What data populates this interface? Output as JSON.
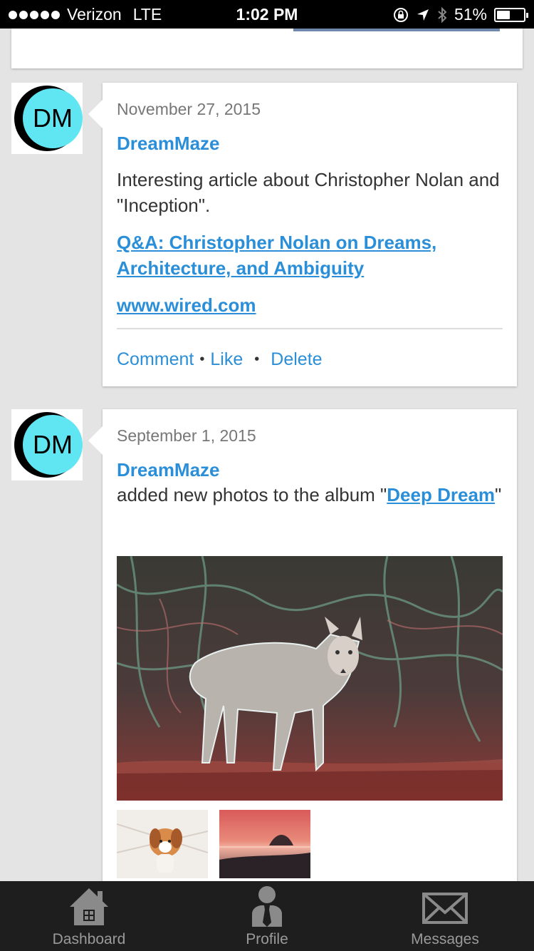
{
  "status_bar": {
    "carrier": "Verizon",
    "network": "LTE",
    "time": "1:02 PM",
    "battery": "51%",
    "battery_level": 0.51
  },
  "posts": [
    {
      "date": "November 27, 2015",
      "author": "DreamMaze",
      "avatar_text": "DM",
      "text": "Interesting article about Christopher Nolan and \"Inception\".",
      "link_title": "Q&A: Christopher Nolan on Dreams, Architecture, and Ambiguity",
      "link_domain": "www.wired.com",
      "actions": {
        "comment": "Comment",
        "like": "Like",
        "delete": "Delete"
      }
    },
    {
      "date": "September 1, 2015",
      "author": "DreamMaze",
      "avatar_text": "DM",
      "text_before": "added new photos to the album \"",
      "album_name": "Deep Dream",
      "text_after": "\""
    }
  ],
  "tabs": [
    {
      "label": "Dashboard",
      "icon": "house-icon"
    },
    {
      "label": "Profile",
      "icon": "person-icon"
    },
    {
      "label": "Messages",
      "icon": "envelope-icon"
    }
  ],
  "colors": {
    "link": "#2a8fd8",
    "avatar": "#5fe6f2",
    "tab_bar": "#1e1e1e"
  }
}
